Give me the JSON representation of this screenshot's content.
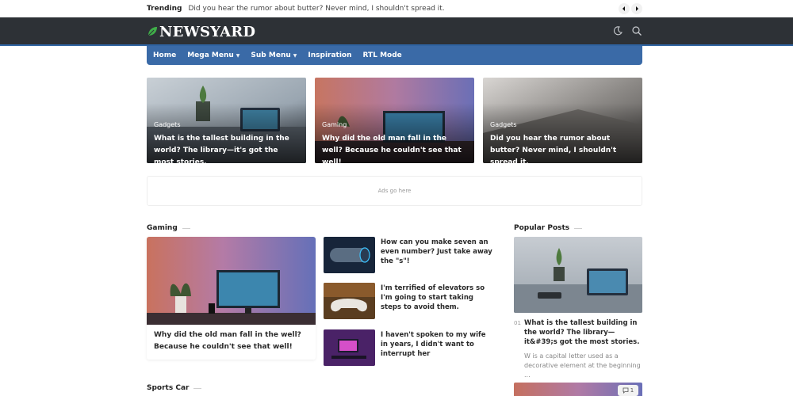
{
  "trending": {
    "label": "Trending",
    "text": "Did you hear the rumor about butter? Never mind, I shouldn't spread it."
  },
  "logo": {
    "text": "NEWSYARD"
  },
  "nav": {
    "items": [
      {
        "label": "Home",
        "has_caret": false
      },
      {
        "label": "Mega Menu",
        "has_caret": true
      },
      {
        "label": "Sub Menu",
        "has_caret": true
      },
      {
        "label": "Inspiration",
        "has_caret": false
      },
      {
        "label": "RTL Mode",
        "has_caret": false
      }
    ]
  },
  "featured": [
    {
      "category": "Gadgets",
      "title": "What is the tallest building in the world? The library—it's got the most stories."
    },
    {
      "category": "Gaming",
      "title": "Why did the old man fall in the well? Because he couldn't see that well!"
    },
    {
      "category": "Gadgets",
      "title": "Did you hear the rumor about butter? Never mind, I shouldn't spread it."
    }
  ],
  "ad": {
    "text": "Ads go here"
  },
  "sections": {
    "gaming": "Gaming",
    "popular": "Popular Posts",
    "sports": "Sports Car"
  },
  "gaming_big": {
    "title": "Why did the old man fall in the well? Because he couldn't see that well!"
  },
  "gaming_list": [
    {
      "title": "How can you make seven an even number? Just take away the \"s\"!"
    },
    {
      "title": "I'm terrified of elevators so I'm going to start taking steps to avoid them."
    },
    {
      "title": "I haven't spoken to my wife in years, I didn't want to interrupt her"
    }
  ],
  "popular": {
    "number": "01",
    "title": "What is the tallest building in the world? The library—it&#39;s got the most stories.",
    "excerpt": "W is a capital letter used as a decorative element at the beginning ...",
    "comment_count": "1"
  },
  "colors": {
    "header_bg": "#2d3136",
    "nav_bg": "#3a6aa7",
    "accent": "#2f63a1",
    "leaf": "#3fae49"
  }
}
